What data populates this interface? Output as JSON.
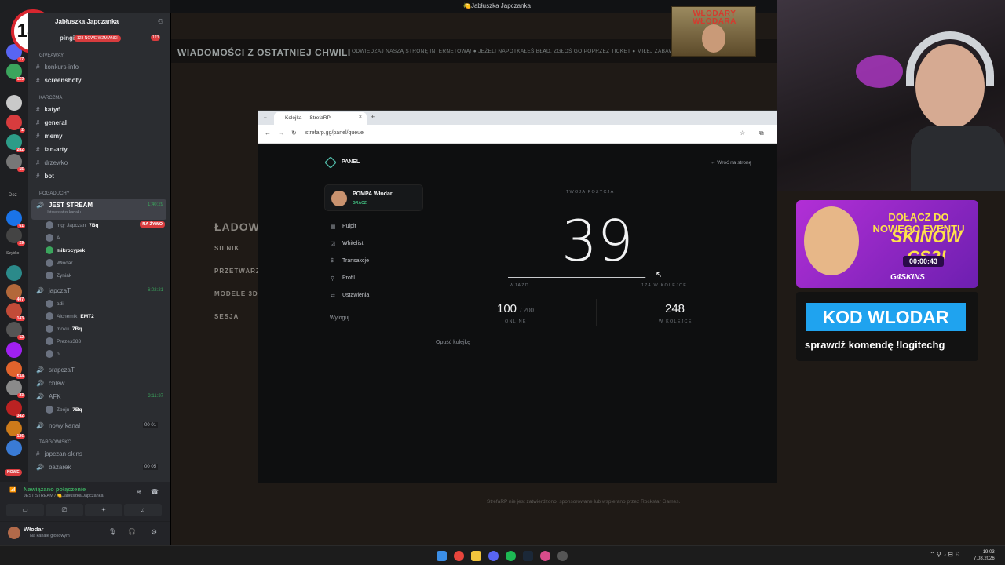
{
  "window": {
    "title": "🍋Jabłuszka Japczanka"
  },
  "overlay": {
    "age_badge": "18+"
  },
  "discord": {
    "server_name": "Jabłuszka Japczanka",
    "pings_channel": "pingi",
    "mentions_badge": "123 NOWE WZMIANKI",
    "mentions_count": "123",
    "categories": {
      "giveaway": "GIVEAWAY",
      "karczma": "KARCZMA",
      "pogaduchy": "POGADUCHY",
      "targowisko": "TARGOWISKO"
    },
    "text_channels": {
      "konkurs": "konkurs-info",
      "screenshoty": "screenshoty",
      "katyn": "katyń",
      "general": "general",
      "memy": "memy",
      "fanarty": "fan-arty",
      "drzewko": "drzewko",
      "bot": "bot",
      "skins": "japczan-skins",
      "bazarek": "bazarek"
    },
    "voice_channels": {
      "jest_stream": {
        "name": "JEST STREAM",
        "status": "Ustaw status kanału",
        "time": "1:40:29",
        "live": "NA ŻYWO"
      },
      "japczat": {
        "name": "japczaT",
        "time": "6:02:21"
      },
      "srapczat": {
        "name": "srapczaT"
      },
      "chlew": {
        "name": "chlew"
      },
      "afk": {
        "name": "AFK",
        "time": "3:11:37"
      },
      "nowy": {
        "name": "nowy kanał",
        "count": "00",
        "limit": "01"
      },
      "bazarek_count": "00",
      "bazarek_limit": "05"
    },
    "users_stream": [
      "mgr Japczan",
      "A..",
      "mikrocypek",
      "Włodar",
      "Zyniak"
    ],
    "user_tag": "7Bq",
    "users_japczat": [
      "adi",
      "Alchemik",
      "moku",
      "Prezes383",
      "p..."
    ],
    "user_tag2": "EMT2",
    "users_afk": [
      "Zbóju"
    ],
    "server_labels": {
      "doz": "Doz",
      "szybko": "Szybko",
      "nowe": "NOWE"
    },
    "server_badges": [
      "17",
      "123",
      "2",
      "282",
      "15",
      "61",
      "29",
      "407",
      "143",
      "12",
      "534",
      "23",
      "342",
      "126"
    ],
    "voice": {
      "status": "Nawiązano połączenie",
      "channel": "JEST STREAM / 🍋Jabłuszka Japczanka"
    },
    "user": {
      "name": "Włodar",
      "status": "Na kanale głosowym"
    }
  },
  "stream": {
    "news_title": "WIADOMOŚCI Z OSTATNIEJ CHWILI",
    "news_ticker": "ODWIEDZAJ NASZĄ STRONĘ INTERNETOWĄ!   ●   JEŻELI NAPOTKAŁEŚ BŁĄD, ZGŁOŚ GO POPRZEZ TICKET   ●   MIŁEJ ZABAWY NA SERWERZE!",
    "loading_title": "ŁADOW",
    "loading_items": [
      "SILNIK",
      "PRZETWARZA",
      "MODELE 3D",
      "SESJA"
    ],
    "disclaimer": "StrefaRP nie jest zatwierdzono, sponsorowane lub wspierano przez Rockstar Games.",
    "logo_text": "WŁODARY WŁODARA"
  },
  "browser": {
    "tab_title": "Kolejka — StrefaRP",
    "url": "strefarp.gg/panel/queue",
    "panel_label": "PANEL",
    "back_link": "← Wróć na stronę",
    "profile": {
      "name": "POMPA Włodar",
      "role": "GRACZ"
    },
    "nav": [
      "Pulpit",
      "Whitelist",
      "Transakcje",
      "Profil",
      "Ustawienia"
    ],
    "logout": "Wyloguj",
    "queue": {
      "position_label": "TWOJA POZYCJA",
      "position": "39",
      "left_label": "WJAZD",
      "right_label": "174 W KOLEJCE",
      "progress": 0.99,
      "online": "100",
      "online_max": "/ 200",
      "online_label": "ONLINE",
      "in_queue": "248",
      "in_queue_label": "W KOLEJCE",
      "leave": "Opuść kolejkę"
    }
  },
  "promo": {
    "line1": "DOŁĄCZ DO NOWEGO EVENTU",
    "line2": "SKINÓW CS2!",
    "timer": "00:00:43",
    "brand": "G4SKINS",
    "code": "KOD WLODAR",
    "command": "sprawdź komendę !logitechg"
  },
  "taskbar": {
    "time": "19:03",
    "date": "7.08.2026"
  }
}
